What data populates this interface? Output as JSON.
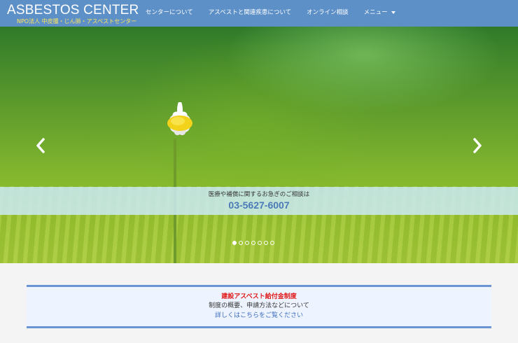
{
  "header": {
    "logo_title": "ASBESTOS CENTER",
    "logo_subtitle": "NPO法人 中皮腫・じん肺・アスベストセンター",
    "nav": [
      {
        "label": "センターについて"
      },
      {
        "label": "アスベストと関連疾患について"
      },
      {
        "label": "オンライン相談"
      },
      {
        "label": "メニュー"
      }
    ]
  },
  "hero": {
    "info_text": "医療や補償に関するお急ぎのご相談は",
    "phone": "03-5627-6007",
    "slide_count": 7,
    "active_slide": 1,
    "prev_icon": "chevron-left-icon",
    "next_icon": "chevron-right-icon"
  },
  "notice": {
    "title": "建設アスベスト給付金制度",
    "description": "制度の概要、申請方法などについて",
    "link": "詳しくはこちらをご覧ください"
  },
  "colors": {
    "navbar": "#5e90c8",
    "subtitle": "#ffe55a",
    "phone": "#4a7ab8",
    "notice_title": "#e01818",
    "notice_border": "#6a95d2",
    "link": "#3d6ebf"
  }
}
